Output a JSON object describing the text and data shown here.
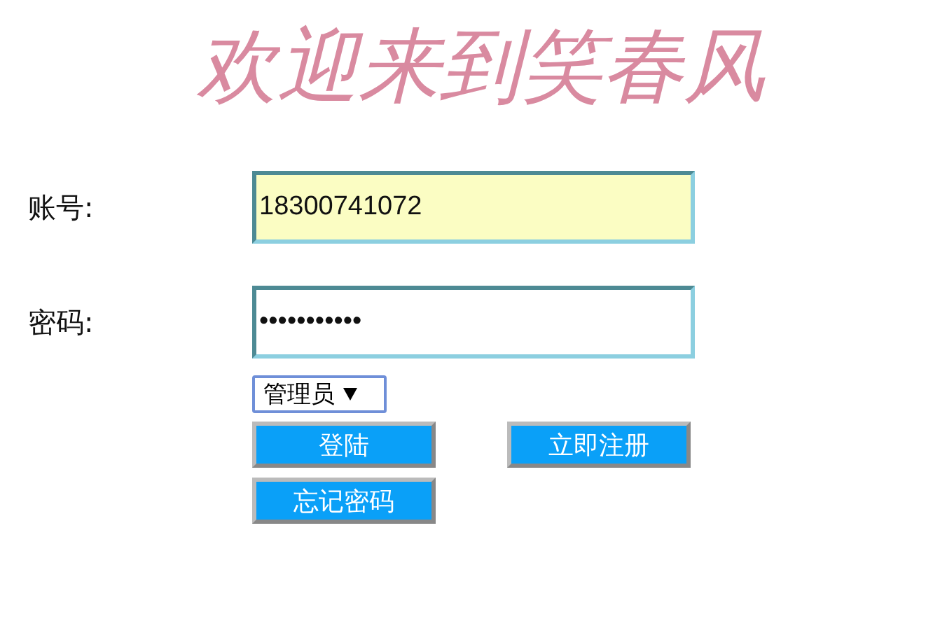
{
  "title": "欢迎来到笑春风",
  "fields": [
    {
      "label": "账号:",
      "value": "18300741072",
      "filled": true
    },
    {
      "label": "密码:",
      "value": "•••••••••••",
      "filled": false
    }
  ],
  "role_select": {
    "value": "管理员"
  },
  "buttons": [
    {
      "label": "登陆"
    },
    {
      "label": "立即注册"
    },
    {
      "label": "忘记密码"
    }
  ]
}
